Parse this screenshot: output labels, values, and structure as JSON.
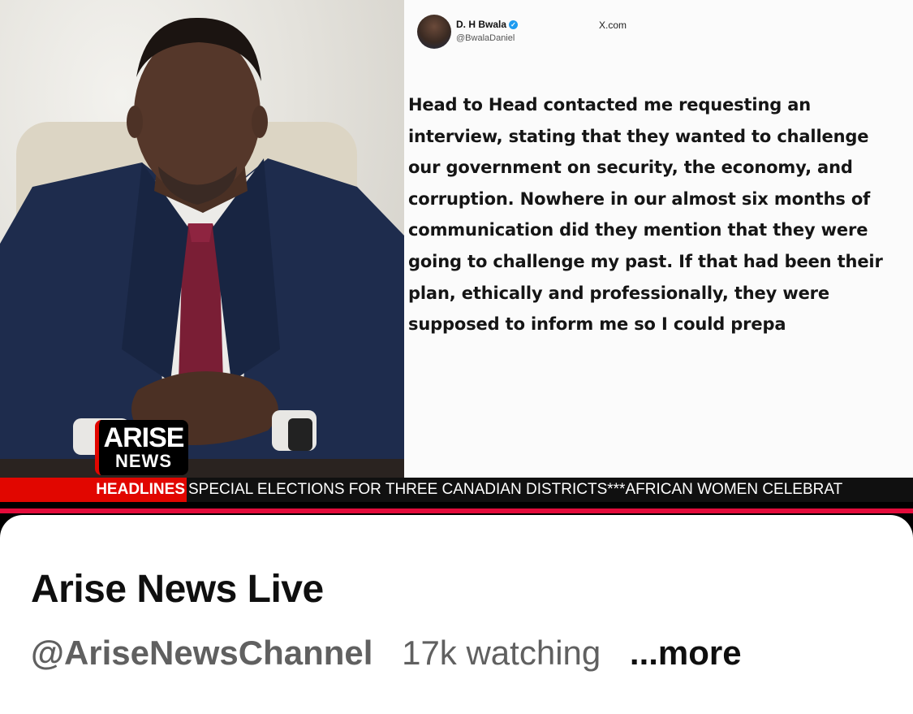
{
  "video": {
    "tweet": {
      "name": "D. H Bwala",
      "handle": "@BwalaDaniel",
      "source": "X.com",
      "body": "Head to Head contacted me requesting an interview, stating that they wanted to challenge our government on security, the economy, and corruption. Nowhere in our almost six months of communication did they mention that they were going to challenge my past. If that had been their plan, ethically and professionally, they were supposed to inform me so I could prepa"
    },
    "logo": {
      "top": "ARISE",
      "bottom": "NEWS"
    },
    "ticker": {
      "label": "HEADLINES",
      "text": "SPECIAL ELECTIONS FOR THREE CANADIAN DISTRICTS***AFRICAN WOMEN CELEBRAT"
    },
    "colors": {
      "ticker_red": "#e10600",
      "accent_bar": "#e30b3b",
      "verified": "#1d9bf0"
    }
  },
  "info": {
    "title": "Arise News Live",
    "channel": "@AriseNewsChannel",
    "watching": "17k watching",
    "more": "...more"
  },
  "icons": {
    "verified": "verified-badge-icon"
  }
}
